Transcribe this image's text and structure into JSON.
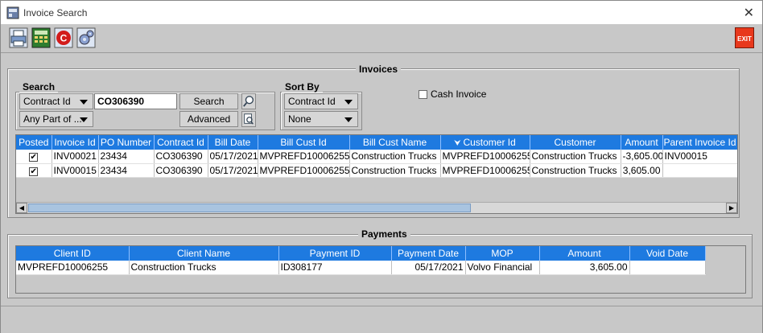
{
  "window": {
    "title": "Invoice Search"
  },
  "toolbar": {
    "exit_label": "EXIT"
  },
  "invoices": {
    "title": "Invoices",
    "search": {
      "title": "Search",
      "field_combo": "Contract Id",
      "match_combo": "Any Part of ...",
      "value": "CO306390",
      "search_label": "Search",
      "advanced_label": "Advanced"
    },
    "sort": {
      "title": "Sort By",
      "primary": "Contract Id",
      "secondary": "None"
    },
    "cash_invoice_label": "Cash Invoice",
    "columns": [
      "Posted",
      "Invoice Id",
      "PO Number",
      "Contract Id",
      "Bill Date",
      "Bill Cust Id",
      "Bill Cust Name",
      "Customer Id",
      "Customer",
      "Amount",
      "Parent Invoice Id"
    ],
    "rows": [
      {
        "posted": "✔",
        "invoice_id": "INV00021",
        "po_number": "23434",
        "contract_id": "CO306390",
        "bill_date": "05/17/2021",
        "bill_cust_id": "MVPREFD10006255",
        "bill_cust_name": "Construction Trucks",
        "customer_id": "MVPREFD10006255",
        "customer": "Construction Trucks",
        "amount": "-3,605.00",
        "parent_invoice_id": "INV00015"
      },
      {
        "posted": "✔",
        "invoice_id": "INV00015",
        "po_number": "23434",
        "contract_id": "CO306390",
        "bill_date": "05/17/2021",
        "bill_cust_id": "MVPREFD10006255",
        "bill_cust_name": "Construction Trucks",
        "customer_id": "MVPREFD10006255",
        "customer": "Construction Trucks",
        "amount": "3,605.00",
        "parent_invoice_id": ""
      }
    ]
  },
  "payments": {
    "title": "Payments",
    "columns": [
      "Client ID",
      "Client Name",
      "Payment ID",
      "Payment Date",
      "MOP",
      "Amount",
      "Void Date"
    ],
    "rows": [
      {
        "client_id": "MVPREFD10006255",
        "client_name": "Construction Trucks",
        "payment_id": "ID308177",
        "payment_date": "05/17/2021",
        "mop": "Volvo Financial",
        "amount": "3,605.00",
        "void_date": ""
      }
    ]
  },
  "colors": {
    "header_blue": "#1e7ae0",
    "exit_red": "#e8381c"
  }
}
